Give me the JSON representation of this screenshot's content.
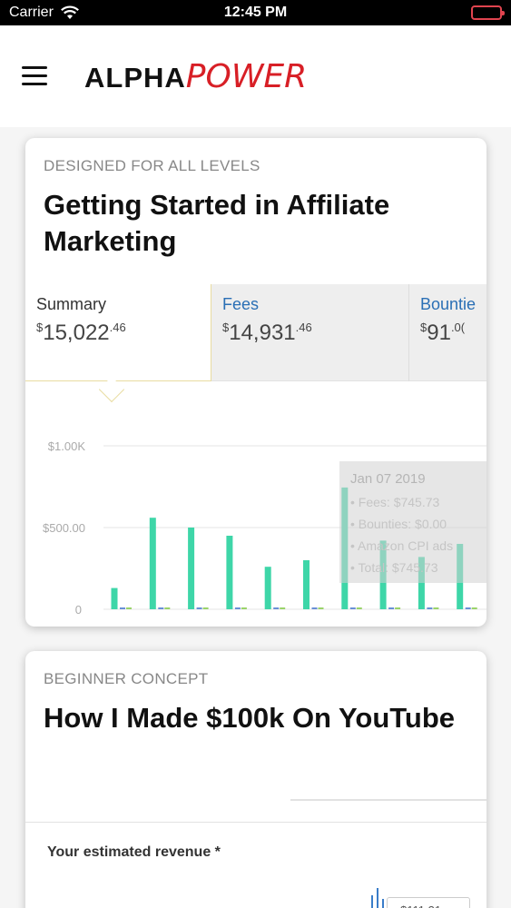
{
  "status_bar": {
    "carrier": "Carrier",
    "time": "12:45 PM",
    "battery_color": "#e0444f"
  },
  "header": {
    "logo_part1": "ALPHA",
    "logo_part2": "POWER",
    "logo_accent": "#d81f26"
  },
  "cards": [
    {
      "tag": "DESIGNED FOR ALL LEVELS",
      "title": "Getting Started in Affiliate Marketing",
      "summary_tabs": [
        {
          "label": "Summary",
          "currency": "$",
          "whole": "15,022",
          "cents": ".46"
        },
        {
          "label": "Fees",
          "currency": "$",
          "whole": "14,931",
          "cents": ".46"
        },
        {
          "label": "Bountie",
          "currency": "$",
          "whole": "91",
          "cents": ".0("
        }
      ]
    },
    {
      "tag": "BEGINNER CONCEPT",
      "title": "How I Made $100k On YouTube",
      "panel_label": "Your estimated revenue *",
      "panel_value": "$111.31"
    }
  ],
  "chart_data": {
    "type": "bar",
    "colors": {
      "fees": "#3ed6a8",
      "bounties": "#6a8fd6",
      "amazon": "#9ad36a"
    },
    "ylim": [
      0,
      1000
    ],
    "y_ticks": [
      "$1.00K",
      "$500.00",
      "0"
    ],
    "series": [
      {
        "name": "Fees",
        "values": [
          130,
          560,
          500,
          450,
          260,
          300,
          745,
          420,
          320,
          400,
          200
        ]
      }
    ],
    "tooltip": {
      "date": "Jan 07 2019",
      "lines": [
        "Fees: $745.73",
        "Bounties: $0.00",
        "Amazon CPI ads",
        "Total: $745.73"
      ]
    }
  }
}
